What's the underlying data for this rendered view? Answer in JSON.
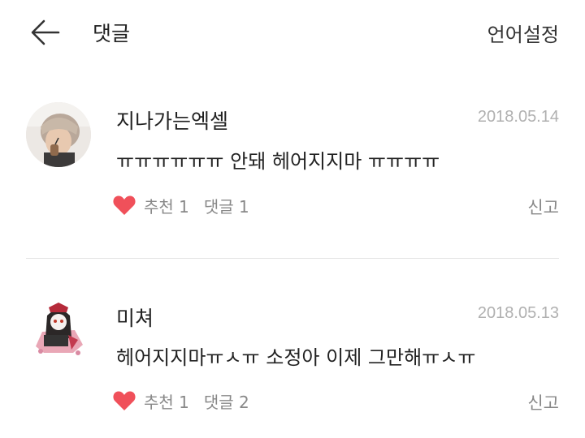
{
  "header": {
    "back_icon": "arrow-left-icon",
    "title": "댓글",
    "language_settings": "언어설정"
  },
  "comments": [
    {
      "username": "지나가는엑셀",
      "date": "2018.05.14",
      "text": "ㅠㅠㅠㅠㅠㅠ 안돼 헤어지지마 ㅠㅠㅠㅠ",
      "like_label": "추천 1",
      "reply_label": "댓글 1",
      "report_label": "신고",
      "heart_icon": "heart-icon",
      "heart_color": "#f0505a"
    },
    {
      "username": "미쳐",
      "date": "2018.05.13",
      "text": "헤어지지마ㅠㅅㅠ 소정아 이제 그만해ㅠㅅㅠ",
      "like_label": "추천 1",
      "reply_label": "댓글 2",
      "report_label": "신고",
      "heart_icon": "heart-icon",
      "heart_color": "#f0505a"
    }
  ]
}
